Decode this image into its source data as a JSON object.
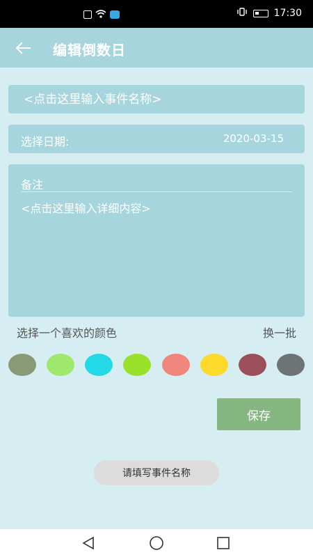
{
  "status_bar": {
    "time": "17:30",
    "icons": [
      "sim-icon",
      "wifi-icon",
      "app-notification-icon",
      "vibrate-icon",
      "battery-icon"
    ]
  },
  "header": {
    "title": "编辑倒数日",
    "back_icon": "arrow-left-icon"
  },
  "form": {
    "title_placeholder": "<点击这里输入事件名称>",
    "date_label": "选择日期:",
    "date_value": "2020-03-15",
    "notes_label": "备注",
    "notes_placeholder": "<点击这里输入详细内容>"
  },
  "colors": {
    "label": "选择一个喜欢的颜色",
    "shuffle_label": "换一批",
    "swatches": [
      "#8b9a76",
      "#9ee86d",
      "#24d9e6",
      "#99e12a",
      "#f0857c",
      "#fdd92c",
      "#9b4f58",
      "#6e7475"
    ]
  },
  "actions": {
    "save_label": "保存"
  },
  "toast": {
    "message": "请填写事件名称"
  },
  "nav": {
    "icons": [
      "back-triangle-icon",
      "home-circle-icon",
      "recent-square-icon"
    ]
  },
  "theme": {
    "primary": "#a6d5dd",
    "background": "#d6eef1",
    "save": "#86b681"
  }
}
